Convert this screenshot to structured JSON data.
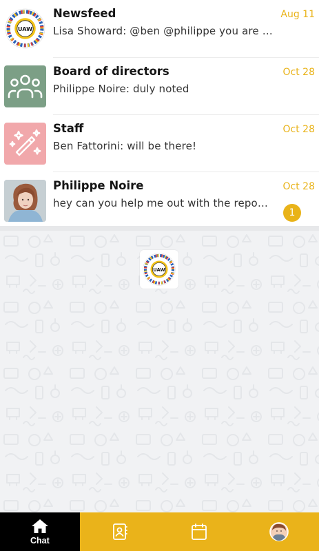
{
  "chats": [
    {
      "id": "newsfeed",
      "title": "Newsfeed",
      "preview": "Lisa Showard: @ben @philippe you are …",
      "date": "Aug 11",
      "avatar": "uaw-logo",
      "unread": null
    },
    {
      "id": "board",
      "title": "Board of directors",
      "preview": "Philippe Noire: duly noted",
      "date": "Oct 28",
      "avatar": "group-icon",
      "avatar_color": "#7c9f86",
      "unread": null
    },
    {
      "id": "staff",
      "title": "Staff",
      "preview": "Ben Fattorini: will be there!",
      "date": "Oct 28",
      "avatar": "magic-wand-icon",
      "avatar_color": "#f1a8ab",
      "unread": null
    },
    {
      "id": "philippe",
      "title": "Philippe Noire",
      "preview": "hey can you help me out with the repo…",
      "date": "Oct 28",
      "avatar": "user-photo",
      "unread": "1"
    }
  ],
  "logo_text": "UAW",
  "tabs": [
    {
      "id": "chat",
      "label": "Chat",
      "icon": "home-icon",
      "active": true
    },
    {
      "id": "contacts",
      "label": "",
      "icon": "contacts-icon",
      "active": false
    },
    {
      "id": "calendar",
      "label": "",
      "icon": "calendar-icon",
      "active": false
    },
    {
      "id": "profile",
      "label": "",
      "icon": "profile-avatar",
      "active": false
    }
  ],
  "colors": {
    "accent": "#eab31a",
    "date": "#e9b319",
    "board_avatar": "#7c9f86",
    "staff_avatar": "#f1a8ab",
    "active_tab": "#000000"
  }
}
